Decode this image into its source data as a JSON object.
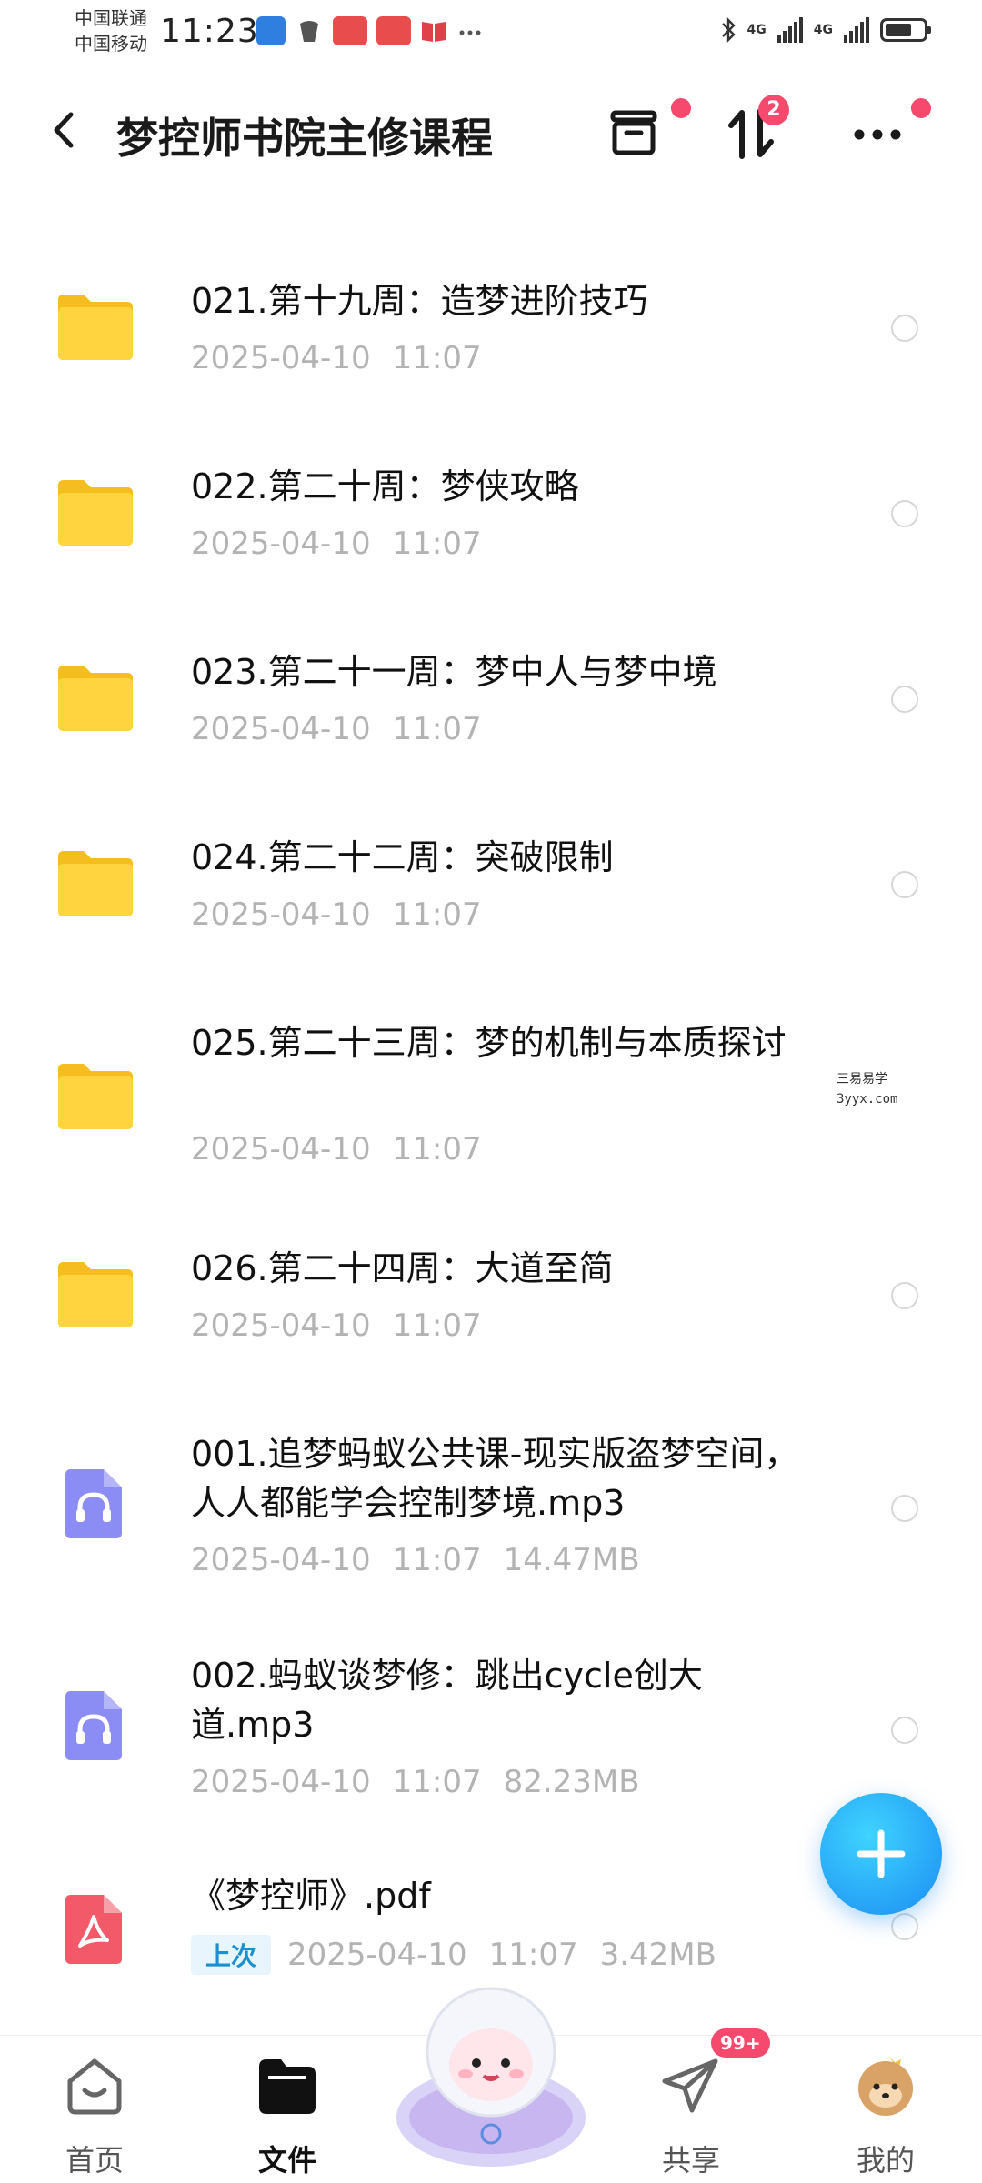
{
  "status_bar": {
    "carrier_1": "中国联通",
    "carrier_2": "中国移动",
    "time": "11:23",
    "net_1": "4G",
    "net_2": "4G",
    "battery_level": 0.7
  },
  "header": {
    "title": "梦控师书院主修课程",
    "sort_badge": "2",
    "icons": [
      "back-icon",
      "archive-icon",
      "sort-icon",
      "more-icon"
    ]
  },
  "files": [
    {
      "name": "021.第十九周：造梦进阶技巧",
      "date": "2025-04-10",
      "time": "11:07",
      "size": "",
      "type": "folder"
    },
    {
      "name": "022.第二十周：梦侠攻略",
      "date": "2025-04-10",
      "time": "11:07",
      "size": "",
      "type": "folder"
    },
    {
      "name": "023.第二十一周：梦中人与梦中境",
      "date": "2025-04-10",
      "time": "11:07",
      "size": "",
      "type": "folder"
    },
    {
      "name": "024.第二十二周：突破限制",
      "date": "2025-04-10",
      "time": "11:07",
      "size": "",
      "type": "folder"
    },
    {
      "name": "025.第二十三周：梦的机制与本质探讨",
      "date": "2025-04-10",
      "time": "11:07",
      "size": "",
      "type": "folder"
    },
    {
      "name": "026.第二十四周：大道至简",
      "date": "2025-04-10",
      "time": "11:07",
      "size": "",
      "type": "folder"
    },
    {
      "name": "001.追梦蚂蚁公共课-现实版盗梦空间，人人都能学会控制梦境.mp3",
      "date": "2025-04-10",
      "time": "11:07",
      "size": "14.47MB",
      "type": "audio"
    },
    {
      "name": "002.蚂蚁谈梦修：跳出cycle创大道.mp3",
      "date": "2025-04-10",
      "time": "11:07",
      "size": "82.23MB",
      "type": "audio"
    },
    {
      "name": "《梦控师》.pdf",
      "date": "2025-04-10",
      "time": "11:07",
      "size": "3.42MB",
      "type": "pdf",
      "tag": "上次"
    }
  ],
  "watermark": {
    "line1": "三易易学",
    "line2": "3yyx.com"
  },
  "bottom_nav": {
    "home": "首页",
    "files": "文件",
    "share": "共享",
    "mine": "我的",
    "share_badge": "99+"
  },
  "colors": {
    "accent": "#1b8cf2",
    "badge": "#f54a6e",
    "folder": "#ffcf33",
    "audio": "#8c8cf5",
    "pdf": "#f25a6a",
    "tag_text": "#1c8fd1"
  }
}
